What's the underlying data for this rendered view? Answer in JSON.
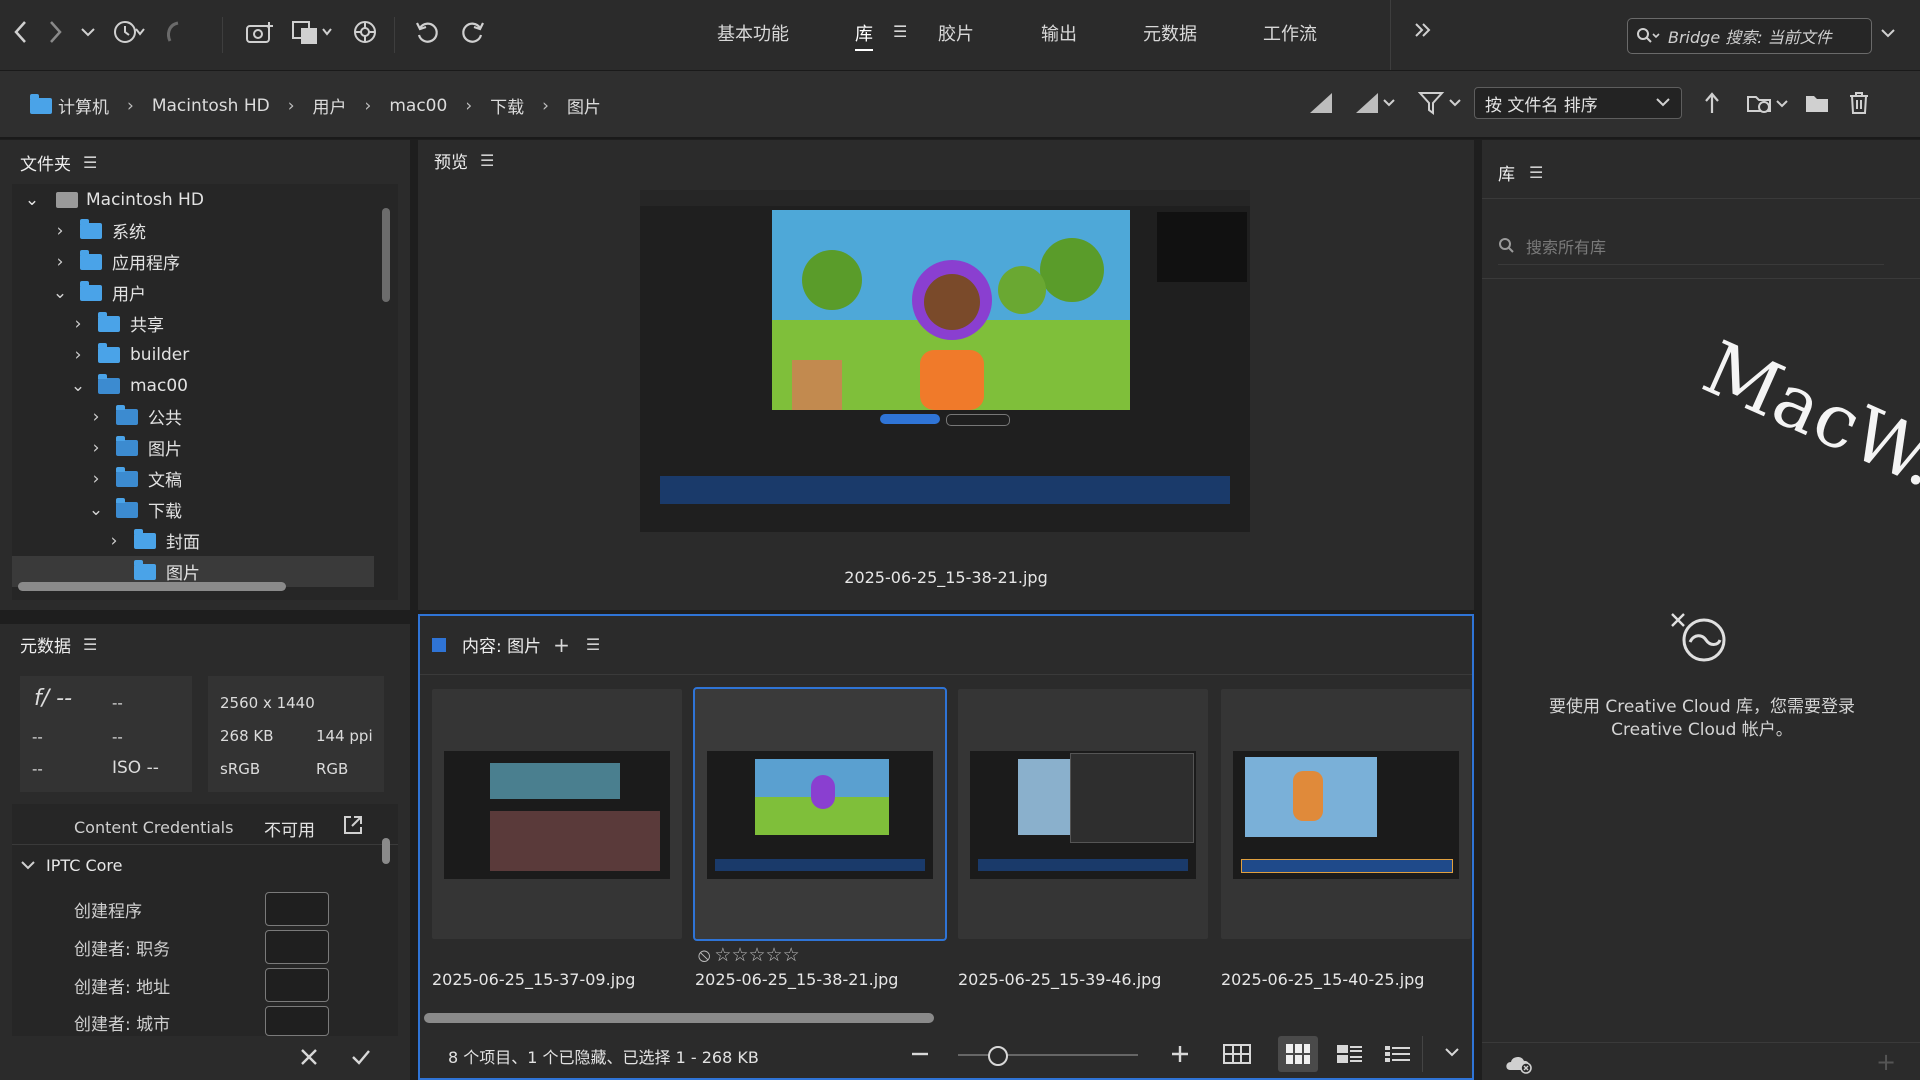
{
  "topbar": {
    "workspace_tabs": [
      "基本功能",
      "库",
      "胶片",
      "输出",
      "元数据",
      "工作流"
    ],
    "active_tab": "库",
    "search_placeholder": "Bridge 搜索: 当前文件"
  },
  "pathbar": {
    "breadcrumbs": [
      "计算机",
      "Macintosh HD",
      "用户",
      "mac00",
      "下载",
      "图片"
    ],
    "sort_label": "按 文件名 排序"
  },
  "folders_panel": {
    "title": "文件夹",
    "items": [
      {
        "label": "Macintosh HD"
      },
      {
        "label": "系统"
      },
      {
        "label": "应用程序"
      },
      {
        "label": "用户"
      },
      {
        "label": "共享"
      },
      {
        "label": "builder"
      },
      {
        "label": "mac00"
      },
      {
        "label": "公共"
      },
      {
        "label": "图片"
      },
      {
        "label": "文稿"
      },
      {
        "label": "下载"
      },
      {
        "label": "封面"
      },
      {
        "label": "图片"
      }
    ]
  },
  "metadata_panel": {
    "title": "元数据",
    "fstop": "f/ --",
    "shutter": "--",
    "row2_a": "--",
    "row2_b": "--",
    "row3_a": "--",
    "iso": "ISO --",
    "dimensions": "2560 x 1440",
    "size": "268 KB",
    "ppi": "144 ppi",
    "colorspace": "sRGB",
    "mode": "RGB",
    "credentials_label": "Content Credentials",
    "credentials_value": "不可用",
    "iptc_title": "IPTC Core",
    "iptc_fields": [
      "创建程序",
      "创建者: 职务",
      "创建者: 地址",
      "创建者: 城市"
    ]
  },
  "preview_panel": {
    "title": "预览",
    "filename": "2025-06-25_15-38-21.jpg"
  },
  "content_panel": {
    "title": "内容: 图片",
    "thumbnails": [
      {
        "name": "2025-06-25_15-37-09.jpg"
      },
      {
        "name": "2025-06-25_15-38-21.jpg"
      },
      {
        "name": "2025-06-25_15-39-46.jpg"
      },
      {
        "name": "2025-06-25_15-40-25.jpg"
      }
    ],
    "status": "8 个项目、1 个已隐藏、已选择 1 - 268 KB"
  },
  "library_panel": {
    "title": "库",
    "search_placeholder": "搜索所有库",
    "message": "要使用 Creative Cloud 库，您需要登录 Creative Cloud 帐户。"
  },
  "watermark": "MacW.com",
  "colors": {
    "accent": "#2f74d6",
    "folder": "#4aa3e8",
    "panel": "#2b2b2b",
    "background": "#1e1e1e"
  }
}
